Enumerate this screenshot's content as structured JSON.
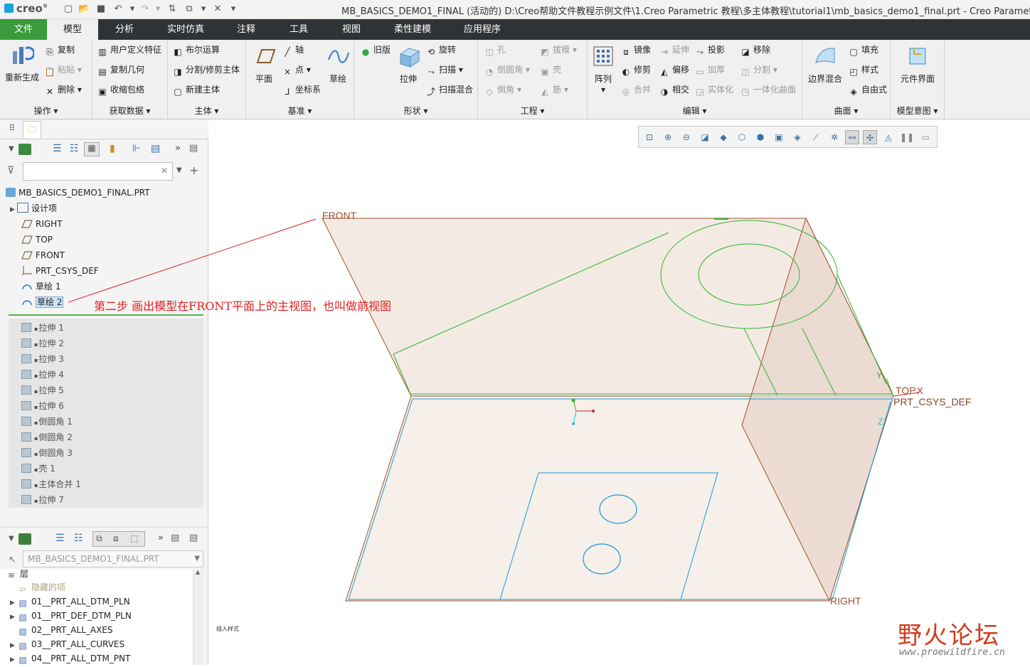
{
  "app": {
    "logo": "creo°",
    "title": "MB_BASICS_DEMO1_FINAL (活动的) D:\\Creo帮助文件教程示例文件\\1.Creo Parametric 教程\\多主体教程\\tutorial1\\mb_basics_demo1_final.prt - Creo Parametric"
  },
  "tabs": [
    {
      "label": "文件"
    },
    {
      "label": "模型"
    },
    {
      "label": "分析"
    },
    {
      "label": "实时仿真"
    },
    {
      "label": "注释"
    },
    {
      "label": "工具"
    },
    {
      "label": "视图"
    },
    {
      "label": "柔性建模"
    },
    {
      "label": "应用程序"
    }
  ],
  "ribbon": {
    "ops": {
      "label": "操作",
      "regen": "重新生成",
      "copy": "复制",
      "paste": "粘贴",
      "delete": "删除"
    },
    "getdata": {
      "label": "获取数据",
      "udf": "用户定义特征",
      "copygeom": "复制几何",
      "shrinkwrap": "收缩包络"
    },
    "body": {
      "label": "主体",
      "boolean": "布尔运算",
      "split": "分割/修剪主体",
      "newbody": "新建主体"
    },
    "datum": {
      "label": "基准",
      "plane": "平面",
      "axis": "轴",
      "point": "点",
      "csys": "坐标系",
      "sketch": "草绘"
    },
    "shapes": {
      "label": "形状",
      "legacy": "旧版",
      "extrude": "拉伸",
      "revolve": "旋转",
      "sweep": "扫描",
      "sweepblend": "扫描混合"
    },
    "eng": {
      "label": "工程",
      "hole": "孔",
      "draft": "拔模",
      "round": "倒圆角",
      "shell": "壳",
      "chamfer": "倒角",
      "rib": "筋"
    },
    "edit": {
      "label": "编辑",
      "pattern": "阵列",
      "mirror": "镜像",
      "extend": "延伸",
      "project": "投影",
      "move": "移除",
      "trim": "修剪",
      "offset": "偏移",
      "thicken": "加厚",
      "split": "分割",
      "merge": "合并",
      "intersect": "相交",
      "solidify": "实体化",
      "unify": "一体化曲面"
    },
    "surfaces": {
      "label": "曲面",
      "boundary": "边界混合",
      "fill": "填充",
      "style": "样式",
      "freestyle": "自由式"
    },
    "intent": {
      "label": "模型意图",
      "component": "元件界面"
    }
  },
  "tree": {
    "root": "MB_BASICS_DEMO1_FINAL.PRT",
    "items": [
      {
        "label": "设计项"
      },
      {
        "label": "RIGHT"
      },
      {
        "label": "TOP"
      },
      {
        "label": "FRONT"
      },
      {
        "label": "PRT_CSYS_DEF"
      },
      {
        "label": "草绘 1"
      },
      {
        "label": "草绘 2"
      }
    ],
    "suppressed": [
      {
        "label": "拉伸 1"
      },
      {
        "label": "拉伸 2"
      },
      {
        "label": "拉伸 3"
      },
      {
        "label": "拉伸 4"
      },
      {
        "label": "拉伸 5"
      },
      {
        "label": "拉伸 6"
      },
      {
        "label": "倒圆角 1"
      },
      {
        "label": "倒圆角 2"
      },
      {
        "label": "倒圆角 3"
      },
      {
        "label": "壳 1"
      },
      {
        "label": "主体合并 1"
      },
      {
        "label": "拉伸 7"
      }
    ]
  },
  "layers": {
    "model": "MB_BASICS_DEMO1_FINAL.PRT",
    "header": "层",
    "items": [
      {
        "label": "隐藏的项"
      },
      {
        "label": "01__PRT_ALL_DTM_PLN"
      },
      {
        "label": "01__PRT_DEF_DTM_PLN"
      },
      {
        "label": "02__PRT_ALL_AXES"
      },
      {
        "label": "03__PRT_ALL_CURVES"
      },
      {
        "label": "04__PRT_ALL_DTM_PNT"
      }
    ]
  },
  "viewport": {
    "labels": {
      "front": "FRONT",
      "top": "TOP",
      "x": "X",
      "csys": "PRT_CSYS_DEF",
      "right": "RIGHT",
      "y": "Y",
      "z": "Z"
    },
    "annotation": "第二步  画出模型在FRONT平面上的主视图，也叫做前视图",
    "small_text": "插入样式"
  },
  "watermark": {
    "name": "野火论坛",
    "url": "www.proewildfire.cn"
  },
  "colors": {
    "tab_bar": "#2f3336",
    "file_tab": "#3a9b3a",
    "plane_fill": "#f2e6df",
    "plane_edge": "#a0522d",
    "sketch": "#2db52d",
    "sketch2": "#1a9ad6",
    "annot": "#e02020"
  }
}
